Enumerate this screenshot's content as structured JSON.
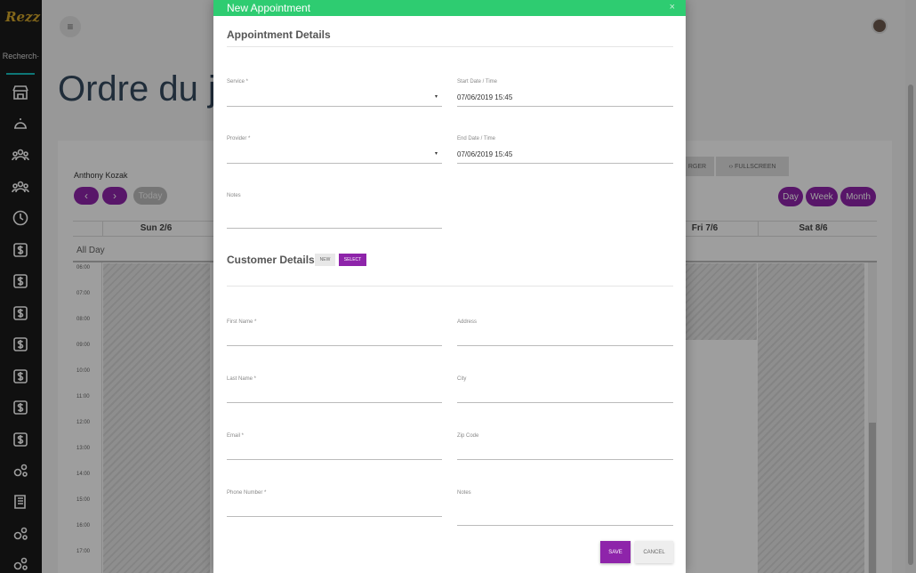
{
  "sidebar": {
    "logo": "Rezz",
    "search_label": "Recherch·",
    "items": [
      {
        "icon": "store-icon"
      },
      {
        "icon": "service-bell-icon"
      },
      {
        "icon": "users-icon"
      },
      {
        "icon": "users-group-icon"
      },
      {
        "icon": "clock-icon"
      },
      {
        "icon": "dollar-icon"
      },
      {
        "icon": "dollar-icon"
      },
      {
        "icon": "dollar-icon"
      },
      {
        "icon": "dollar-icon"
      },
      {
        "icon": "dollar-icon"
      },
      {
        "icon": "dollar-icon"
      },
      {
        "icon": "dollar-icon"
      },
      {
        "icon": "gears-icon"
      },
      {
        "icon": "book-icon"
      },
      {
        "icon": "gears-icon"
      },
      {
        "icon": "gears-icon"
      }
    ]
  },
  "header": {
    "menu_icon": "≡",
    "page_title": "Ordre du jo"
  },
  "calendar": {
    "provider_name": "Anthony Kozak",
    "prev_icon": "‹",
    "next_icon": "›",
    "today_label": "Today",
    "tool_partial_label": "RGER",
    "fullscreen_label": "‹› FULLSCREEN",
    "views": {
      "day": "Day",
      "week": "Week",
      "month": "Month"
    },
    "columns": {
      "sun": "Sun 2/6",
      "fri": "Fri 7/6",
      "sat": "Sat 8/6"
    },
    "all_day_label": "All Day",
    "time_slots": [
      "06:00",
      "07:00",
      "08:00",
      "09:00",
      "10:00",
      "11:00",
      "12:00",
      "13:00",
      "14:00",
      "15:00",
      "16:00",
      "17:00"
    ]
  },
  "modal": {
    "title": "New Appointment",
    "close_icon": "×",
    "appointment_section": "Appointment Details",
    "service_label": "Service *",
    "provider_label": "Provider *",
    "notes_label": "Notes",
    "start_label": "Start Date / Time",
    "start_value": "07/06/2019 15:45",
    "end_label": "End Date / Time",
    "end_value": "07/06/2019 15:45",
    "caret": "▾",
    "customer_section": "Customer Details",
    "new_label": "NEW",
    "select_label": "SELECT",
    "first_name_label": "First Name *",
    "last_name_label": "Last Name *",
    "email_label": "Email *",
    "phone_label": "Phone Number *",
    "address_label": "Address",
    "city_label": "City",
    "zip_label": "Zip Code",
    "customer_notes_label": "Notes",
    "save_label": "SAVE",
    "cancel_label": "CANCEL"
  },
  "colors": {
    "accent": "#8e24aa",
    "header_green": "#2ecc71",
    "sidebar_bg": "#1a1a1a"
  }
}
